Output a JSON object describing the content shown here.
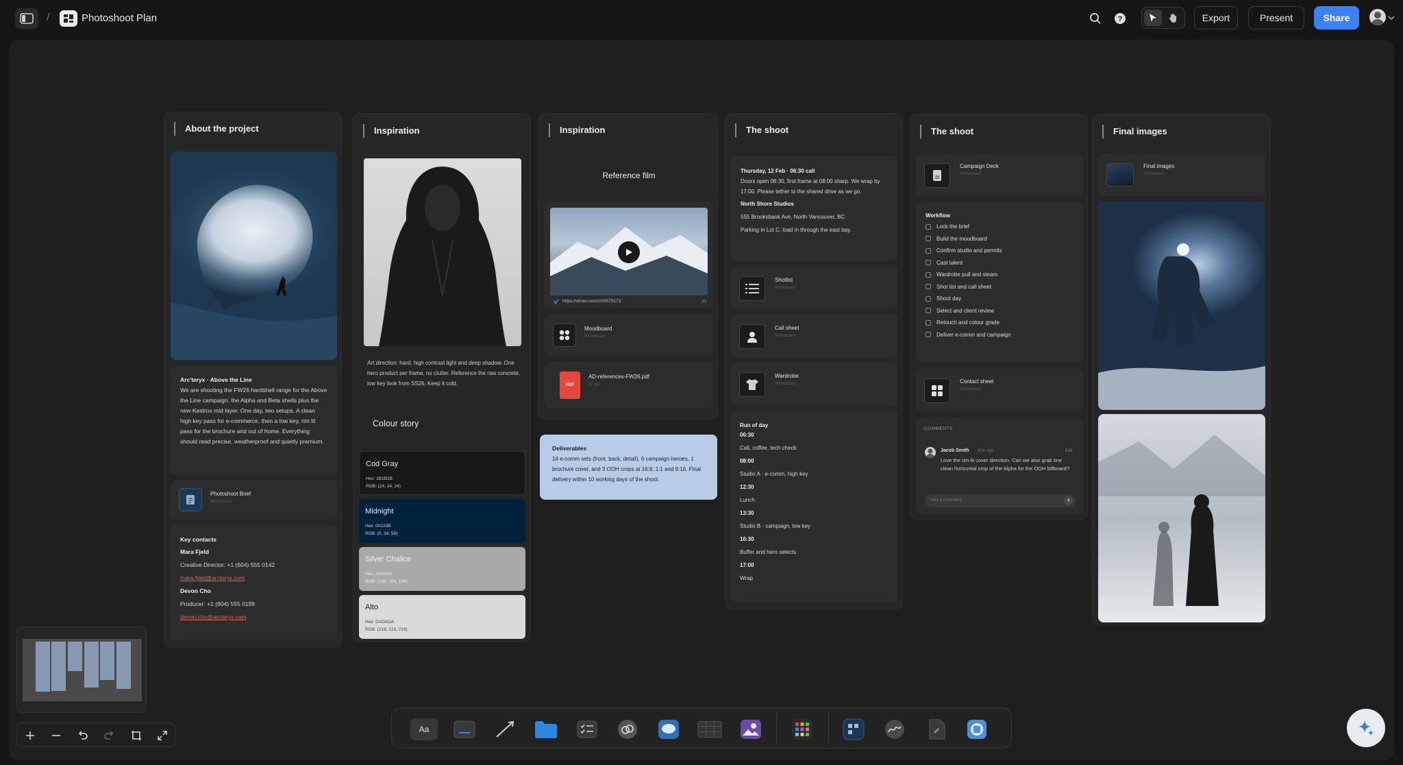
{
  "app": {
    "title": "Photoshoot Plan",
    "breadcrumb_sep": "/"
  },
  "toolbar": {
    "export": "Export",
    "present": "Present",
    "share": "Share"
  },
  "columns": {
    "about": {
      "title": "About the project",
      "brief_title": "Arc'teryx · Above the Line",
      "brief_body": "We are shooting the FW26 hardshell range for the Above the Line campaign: the Alpha and Beta shells plus the new Kestros mid layer. One day, two setups. A clean high key pass for e-commerce, then a low key, rim lit pass for the brochure and out of home. Everything should read precise, weatherproof and quietly premium.",
      "doc_title": "Photoshoot Brief",
      "doc_sub": "Whiteboard",
      "contacts_title": "Key contacts",
      "contacts": [
        {
          "name": "Mara Fjeld",
          "role": "Creative Director: +1 (604) 555 0142",
          "email": "mara.fjeld@arcteryx.com"
        },
        {
          "name": "Devon Cho",
          "role": "Producer: +1 (604) 555 0199",
          "email": "devon.cho@arcteryx.com"
        }
      ]
    },
    "insp1": {
      "title": "Inspiration",
      "art_direction": "Art direction: hard, high contrast light and deep shadow. One hero product per frame, no clutter. Reference the raw concrete, low key look from SS26. Keep it cold.",
      "colour_title": "Colour story",
      "swatches": [
        {
          "name": "Cod Gray",
          "hex": "Hex: 1B1B1B",
          "rgb": "RGB: (24, 24, 24)",
          "bg": "#181818",
          "fg": "#e8e8e8"
        },
        {
          "name": "Midnight",
          "hex": "Hex: 00223B",
          "rgb": "RGB: (0, 34, 59)",
          "bg": "#00223B",
          "fg": "#e8e8e8"
        },
        {
          "name": "Silver Chalice",
          "hex": "Hex: A9A9A9",
          "rgb": "RGB: (169, 169, 169)",
          "bg": "#A9A9A9",
          "fg": "#f2f2f2"
        },
        {
          "name": "Alto",
          "hex": "Hex: DADADA",
          "rgb": "RGB: (218, 218, 218)",
          "bg": "#DADADA",
          "fg": "#222222"
        }
      ]
    },
    "insp2": {
      "title": "Inspiration",
      "ref_title": "Reference film",
      "video_url": "https://vimeo.com/249579173",
      "moodboard": "Moodboard",
      "moodboard_sub": "Whiteboard",
      "pdf_name": "AD-references-FW26.pdf",
      "pdf_size": "37 KB",
      "pdf_label": "PDF",
      "deliverables_title": "Deliverables",
      "deliverables": "14 e-comm sets (front, back, detail), 6 campaign heroes, 1 brochure cover, and 3 OOH crops at 16:9, 1:1 and 9:16. Final delivery within 10 working days of the shoot."
    },
    "shoot1": {
      "title": "The shoot",
      "call": "Thursday, 12 Feb · 06:30 call",
      "call_body": "Doors open 06:30, first frame at 08:00 sharp. We wrap by 17:00. Please tether to the shared drive as we go.",
      "studio": "North Shore Studios",
      "address": "555 Brooksbank Ave, North Vancouver, BC",
      "parking": "Parking in Lot C, load in through the east bay.",
      "docs": [
        {
          "title": "Shotlist",
          "sub": "Whiteboard"
        },
        {
          "title": "Call sheet",
          "sub": "Whiteboard"
        },
        {
          "title": "Wardrobe",
          "sub": "Whiteboard"
        }
      ],
      "run_title": "Run of day",
      "run": [
        {
          "time": "06:30",
          "item": "Call, coffee, tech check"
        },
        {
          "time": "08:00",
          "item": "Studio A · e-comm, high key"
        },
        {
          "time": "12:30",
          "item": "Lunch"
        },
        {
          "time": "13:30",
          "item": "Studio B · campaign, low key"
        },
        {
          "time": "16:30",
          "item": "Buffer and hero selects"
        },
        {
          "time": "17:00",
          "item": "Wrap"
        }
      ]
    },
    "shoot2": {
      "title": "The shoot",
      "deck": "Campaign Deck",
      "deck_sub": "Whiteboard",
      "workflow_title": "Workflow",
      "workflow": [
        "Lock the brief",
        "Build the moodboard",
        "Confirm studio and permits",
        "Cast talent",
        "Wardrobe pull and steam",
        "Shot list and call sheet",
        "Shoot day",
        "Select and client review",
        "Retouch and colour grade",
        "Deliver e-comm and campaign"
      ],
      "contact_sheet": "Contact sheet",
      "contact_sheet_sub": "Whiteboard",
      "comments_label": "COMMENTS",
      "comment_author": "Jacob Smith",
      "comment_time": "40m ago",
      "comment_edit": "Edit",
      "comment_body": "Love the rim-lit cover direction. Can we also grab one clean horizontal crop of the Alpha for the OOH billboard?",
      "comment_placeholder": "Add a comment..."
    },
    "final": {
      "title": "Final images",
      "doc": "Final images",
      "doc_sub": "Whiteboard"
    }
  },
  "text_tool": "Aa",
  "icons": [
    "sidebar-icon",
    "logo-icon",
    "search-icon",
    "help-icon",
    "pointer-icon",
    "hand-icon",
    "avatar",
    "plus-icon",
    "minus-icon",
    "undo-icon",
    "redo-icon",
    "frame-icon",
    "fit-icon",
    "ai-sparkle-icon"
  ]
}
